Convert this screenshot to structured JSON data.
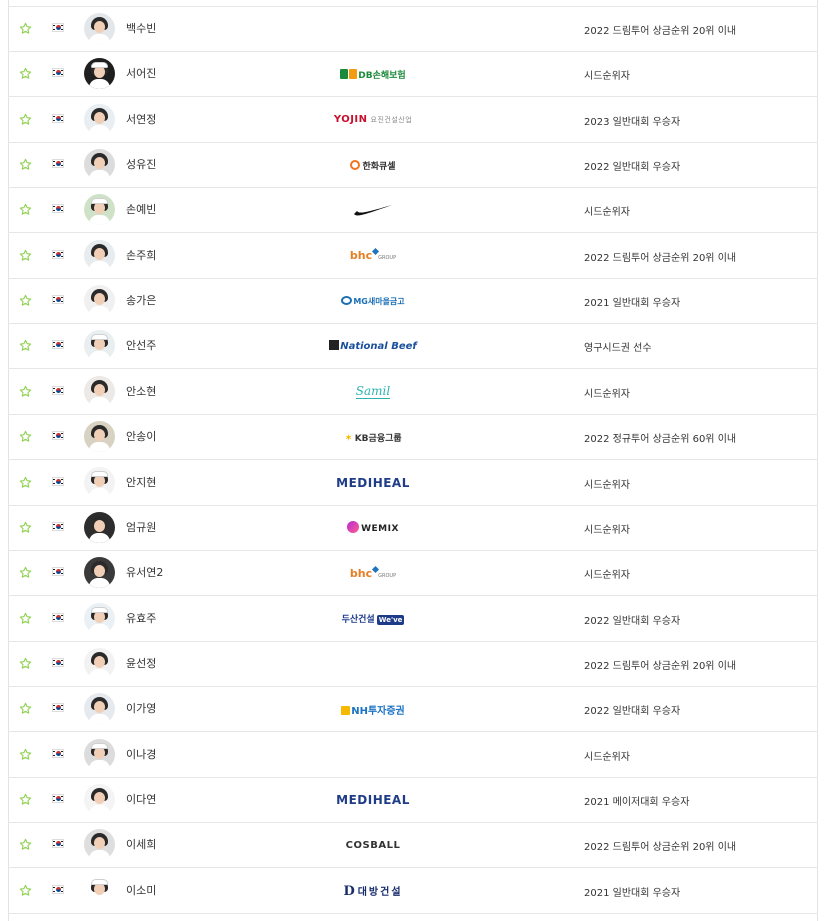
{
  "rows": [
    {
      "name": "백수빈",
      "sponsor": {
        "type": "none",
        "text": ""
      },
      "note": "2022 드림투어 상금순위 20위 이내"
    },
    {
      "name": "서어진",
      "sponsor": {
        "type": "db",
        "text": "DB손해보험"
      },
      "note": "시드순위자"
    },
    {
      "name": "서연정",
      "sponsor": {
        "type": "yojin",
        "text": "YOJIN",
        "sub": "요진건설산업"
      },
      "note": "2023 일반대회 우승자"
    },
    {
      "name": "성유진",
      "sponsor": {
        "type": "hanwha",
        "text": "한화큐셀"
      },
      "note": "2022 일반대회 우승자"
    },
    {
      "name": "손예빈",
      "sponsor": {
        "type": "nike",
        "text": ""
      },
      "note": "시드순위자"
    },
    {
      "name": "손주희",
      "sponsor": {
        "type": "bhc",
        "text": "bhc",
        "sub": "GROUP"
      },
      "note": "2022 드림투어 상금순위 20위 이내"
    },
    {
      "name": "송가은",
      "sponsor": {
        "type": "mg",
        "text": "MG새마을금고"
      },
      "note": "2021 일반대회 우승자"
    },
    {
      "name": "안선주",
      "sponsor": {
        "type": "nb",
        "text": "National Beef"
      },
      "note": "영구시드권 선수"
    },
    {
      "name": "안소현",
      "sponsor": {
        "type": "samil",
        "text": "Samil"
      },
      "note": "시드순위자"
    },
    {
      "name": "안송이",
      "sponsor": {
        "type": "kb",
        "text": "KB금융그룹"
      },
      "note": "2022 정규투어 상금순위 60위 이내"
    },
    {
      "name": "안지현",
      "sponsor": {
        "type": "medi",
        "text": "MEDIHEAL"
      },
      "note": "시드순위자"
    },
    {
      "name": "엄규원",
      "sponsor": {
        "type": "wemix",
        "text": "WEMIX"
      },
      "note": "시드순위자"
    },
    {
      "name": "유서연2",
      "sponsor": {
        "type": "bhc",
        "text": "bhc",
        "sub": "GROUP"
      },
      "note": "시드순위자"
    },
    {
      "name": "유효주",
      "sponsor": {
        "type": "doosan",
        "text": "두산건설",
        "sub": "We've"
      },
      "note": "2022 일반대회 우승자"
    },
    {
      "name": "윤선정",
      "sponsor": {
        "type": "none",
        "text": ""
      },
      "note": "2022 드림투어 상금순위 20위 이내"
    },
    {
      "name": "이가영",
      "sponsor": {
        "type": "nh",
        "text": "NH투자증권"
      },
      "note": "2022 일반대회 우승자"
    },
    {
      "name": "이나경",
      "sponsor": {
        "type": "none",
        "text": ""
      },
      "note": "시드순위자"
    },
    {
      "name": "이다연",
      "sponsor": {
        "type": "medi",
        "text": "MEDIHEAL"
      },
      "note": "2021 메이저대회 우승자"
    },
    {
      "name": "이세희",
      "sponsor": {
        "type": "cos",
        "text": "COSBALL"
      },
      "note": "2022 드림투어 상금순위 20위 이내"
    },
    {
      "name": "이소미",
      "sponsor": {
        "type": "daebang",
        "text": "대방건설",
        "mark": "D"
      },
      "note": "2021 일반대회 우승자"
    }
  ],
  "icons": {
    "favorite": "star-outline-icon",
    "flag": "korea-flag-icon"
  },
  "colors": {
    "star": "#8fd14f",
    "divider": "#e6e6e6",
    "text": "#333333"
  }
}
